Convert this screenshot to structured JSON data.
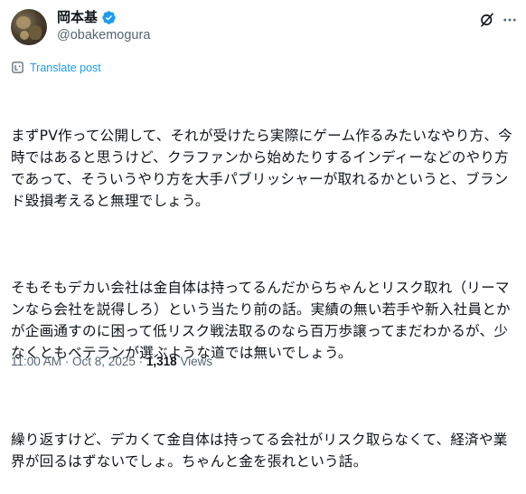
{
  "author": {
    "display_name": "岡本基",
    "handle": "@obakemogura"
  },
  "actions": {
    "translate_label": "Translate post"
  },
  "post": {
    "paragraphs": [
      "まずPV作って公開して、それが受けたら実際にゲーム作るみたいなやり方、今時ではあると思うけど、クラファンから始めたりするインディーなどのやり方であって、そういうやり方を大手パブリッシャーが取れるかというと、ブランド毀損考えると無理でしょう。",
      "そもそもデカい会社は金自体は持ってるんだからちゃんとリスク取れ（リーマンなら会社を説得しろ）という当たり前の話。実績の無い若手や新入社員とかが企画通すのに困って低リスク戦法取るのなら百万歩譲ってまだわかるが、少なくともベテランが選ぶような道では無いでしょう。",
      "繰り返すけど、デカくて金自体は持ってる会社がリスク取らなくて、経済や業界が回るはずないでしょ。ちゃんと金を張れという話。"
    ]
  },
  "meta": {
    "time": "11:00 AM",
    "separator": " · ",
    "date": "Oct 8, 2025",
    "views_count": "1,318",
    "views_label": " Views"
  },
  "colors": {
    "link": "#1d9bf0",
    "secondary_text": "#536471",
    "primary_text": "#0f1419",
    "verified": "#1d9bf0"
  },
  "icons": [
    "verified-badge-icon",
    "grok-icon",
    "more-icon",
    "translate-icon"
  ]
}
